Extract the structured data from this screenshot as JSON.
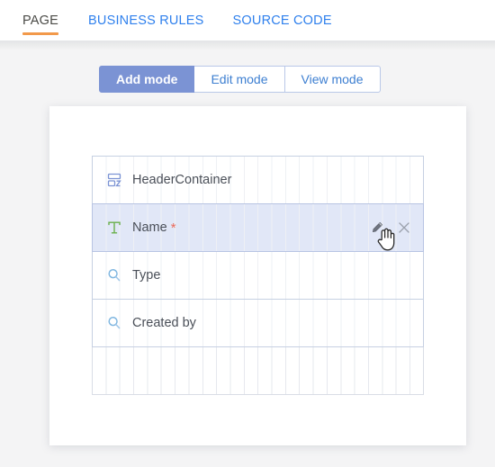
{
  "tabs": [
    {
      "label": "PAGE",
      "active": true
    },
    {
      "label": "BUSINESS RULES",
      "active": false
    },
    {
      "label": "SOURCE CODE",
      "active": false
    }
  ],
  "mode_switcher": {
    "buttons": [
      {
        "label": "Add mode",
        "active": true
      },
      {
        "label": "Edit mode",
        "active": false
      },
      {
        "label": "View mode",
        "active": false
      }
    ]
  },
  "designer": {
    "rows": [
      {
        "label": "HeaderContainer",
        "icon": "container-icon",
        "required": "",
        "selected": false,
        "actions": []
      },
      {
        "label": "Name",
        "icon": "text-field-icon",
        "required": "*",
        "selected": true,
        "actions": [
          "edit-pencil-icon",
          "remove-close-icon"
        ]
      },
      {
        "label": "Type",
        "icon": "lookup-search-icon",
        "required": "",
        "selected": false,
        "actions": []
      },
      {
        "label": "Created by",
        "icon": "lookup-search-icon",
        "required": "",
        "selected": false,
        "actions": []
      }
    ],
    "grid_columns": 24
  },
  "colors": {
    "accent_orange": "#f2994a",
    "link_blue": "#2f80ed",
    "active_mode_blue": "#7b93d4",
    "selected_row_fill": "#e1e7f7",
    "required_star_red": "#eb6a5a",
    "text_icon_green": "#6ab04c",
    "lookup_icon_blue": "#7fb6e0",
    "page_background": "#f4f4f5"
  },
  "cursor": {
    "type": "pointing-hand-cursor"
  }
}
